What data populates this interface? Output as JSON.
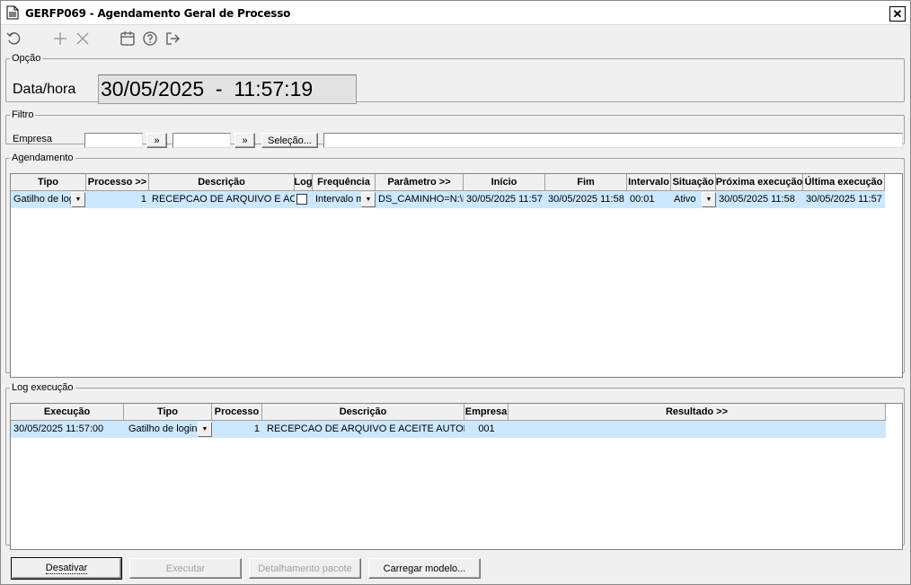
{
  "window": {
    "title": "GERFP069 - Agendamento Geral de Processo",
    "close_label": "✕"
  },
  "toolbar": {
    "icons": [
      "refresh-icon",
      "add-icon",
      "delete-icon",
      "calendar-icon",
      "help-icon",
      "exit-icon"
    ]
  },
  "opcao": {
    "legend": "Opção",
    "data_label": "Data/hora",
    "data_value": "30/05/2025  -  11:57:19"
  },
  "filtro": {
    "legend": "Filtro",
    "empresa_label": "Empresa",
    "empresa_from": "",
    "empresa_to": "",
    "arrow_label": "»",
    "selecao_label": "Seleção...",
    "selecao_value": ""
  },
  "agendamento": {
    "legend": "Agendamento",
    "columns": [
      "Tipo",
      "Processo >>",
      "Descrição",
      "Log",
      "Frequência",
      "Parâmetro >>",
      "Início",
      "Fim",
      "Intervalo",
      "Situação",
      "Próxima execução",
      "Última execução"
    ],
    "rows": [
      {
        "tipo": "Gatilho de login",
        "processo": "1",
        "descricao": "RECEPCAO DE ARQUIVO E ACEITE",
        "log": false,
        "frequencia": "Intervalo m",
        "parametro": "DS_CAMINHO=N:\\D",
        "inicio": "30/05/2025 11:57",
        "fim": "30/05/2025 11:58",
        "intervalo": "00:01",
        "situacao": "Ativo",
        "proxima": "30/05/2025 11:58",
        "ultima": "30/05/2025 11:57"
      }
    ]
  },
  "log": {
    "legend": "Log execução",
    "columns": [
      "Execução",
      "Tipo",
      "Processo",
      "Descrição",
      "Empresa",
      "Resultado >>"
    ],
    "rows": [
      {
        "execucao": "30/05/2025 11:57:00",
        "tipo": "Gatilho de login",
        "processo": "1",
        "descricao": "RECEPCAO DE ARQUIVO E ACEITE AUTOMATICO",
        "empresa": "001",
        "resultado": ""
      }
    ]
  },
  "buttons": {
    "desativar": "Desativar",
    "executar": "Executar",
    "detalhamento": "Detalhamento pacote",
    "carregar": "Carregar modelo..."
  }
}
